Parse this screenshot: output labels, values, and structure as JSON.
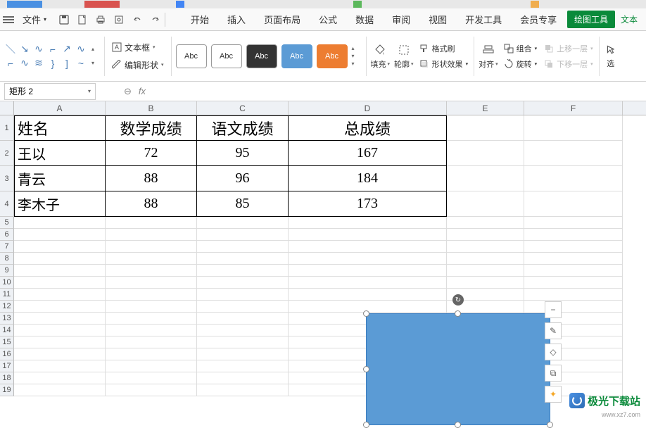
{
  "tabs": {
    "file_label": "文件"
  },
  "menu": {
    "items": [
      "开始",
      "插入",
      "页面布局",
      "公式",
      "数据",
      "审阅",
      "视图",
      "开发工具",
      "会员专享"
    ],
    "drawing_tools": "绘图工具",
    "text_tool": "文本"
  },
  "ribbon": {
    "textbox": "文本框",
    "edit_shape": "编辑形状",
    "style_label": "Abc",
    "fill": "填充",
    "outline": "轮廓",
    "effects": "形状效果",
    "format_painter": "格式刷",
    "align": "对齐",
    "rotate": "旋转",
    "group": "组合",
    "bring_forward": "上移一层",
    "send_backward": "下移一层",
    "select": "选"
  },
  "namebox": {
    "value": "矩形 2"
  },
  "formula": {
    "fx": "fx"
  },
  "columns": [
    "A",
    "B",
    "C",
    "D",
    "E",
    "F"
  ],
  "rows_large": [
    "1",
    "2",
    "3",
    "4"
  ],
  "rows_small": [
    "5",
    "6",
    "7",
    "8",
    "9",
    "10",
    "11",
    "12",
    "13",
    "14",
    "15",
    "16",
    "17",
    "18",
    "19"
  ],
  "table": {
    "headers": [
      "姓名",
      "数学成绩",
      "语文成绩",
      "总成绩"
    ],
    "rows": [
      [
        "王以",
        "72",
        "95",
        "167"
      ],
      [
        "青云",
        "88",
        "96",
        "184"
      ],
      [
        "李木子",
        "88",
        "85",
        "173"
      ]
    ]
  },
  "watermark": {
    "text": "极光下载站",
    "url": "www.xz7.com"
  }
}
